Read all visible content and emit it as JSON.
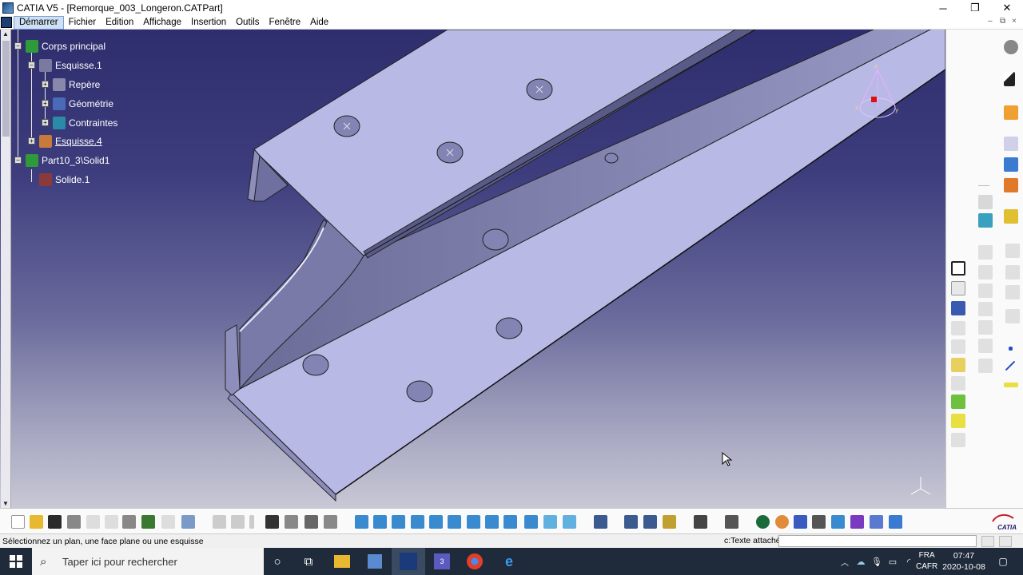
{
  "window": {
    "title": "CATIA V5 - [Remorque_003_Longeron.CATPart]",
    "minimize": "─",
    "restore": "❐",
    "close": "✕"
  },
  "menu": {
    "items": [
      "Démarrer",
      "Fichier",
      "Edition",
      "Affichage",
      "Insertion",
      "Outils",
      "Fenêtre",
      "Aide"
    ],
    "active": "Démarrer",
    "mdi_controls": [
      "–",
      "⧉",
      "×"
    ]
  },
  "tree": {
    "nodes": [
      {
        "label": "Corps principal",
        "icon": "body-icon"
      },
      {
        "label": "Esquisse.1",
        "icon": "sketch-icon"
      },
      {
        "label": "Repère",
        "icon": "axis-system-icon"
      },
      {
        "label": "Géométrie",
        "icon": "geometry-icon"
      },
      {
        "label": "Contraintes",
        "icon": "constraints-icon"
      },
      {
        "label": "Esquisse.4",
        "icon": "sketch-icon",
        "selected": true
      },
      {
        "label": "Part10_3\\Solid1",
        "icon": "solid-body-icon"
      },
      {
        "label": "Solide.1",
        "icon": "solid-icon"
      }
    ]
  },
  "viewport": {
    "background_top": "#2e2e6e",
    "background_bottom": "#c8c8d6",
    "part_color": "#b9b9e6",
    "part_shadow": "#8a8ab8"
  },
  "right_toolbar": {
    "icons": [
      "settings-icon",
      "select-arrow-icon",
      "sketch-edit-icon",
      "text-annotation-icon",
      "measure-icon",
      "pad-icon",
      "pocket-icon",
      "shaft-icon",
      "groove-icon",
      "hole-icon",
      "rib-icon",
      "slot-icon",
      "stiffener-icon",
      "loft-icon",
      "point-icon",
      "line-icon",
      "plane-icon"
    ]
  },
  "bottom_toolbar": {
    "icons": [
      "new-icon",
      "open-icon",
      "save-icon",
      "print-icon",
      "cut-icon",
      "copy-icon",
      "paste-icon",
      "undo-icon",
      "redo-icon",
      "whats-this-icon",
      "formula-icon",
      "knowledge-icon",
      "table-icon",
      "graph-icon",
      "catalog-icon",
      "fly-icon",
      "fit-all-icon",
      "pan-icon",
      "rotate-icon",
      "zoom-in-icon",
      "zoom-out-icon",
      "normal-view-icon",
      "multi-view-icon",
      "iso-view-icon",
      "render-style-icon",
      "hide-show-icon",
      "swap-visible-icon",
      "update-icon",
      "measure-between-icon",
      "mass-icon",
      "inertia-icon",
      "capture-icon",
      "analysis-icon",
      "sync-icon",
      "hand-icon",
      "axis-icon",
      "numeric-icon",
      "cube-icon",
      "tools-icon",
      "list-icon",
      "layer-icon"
    ]
  },
  "brand": {
    "catia_label": "CATIA"
  },
  "status": {
    "message": "Sélectionnez un plan, une face plane ou une esquisse",
    "command_label": "c:Texte attaché",
    "command_value": ""
  },
  "taskbar": {
    "search_placeholder": "Taper ici pour rechercher",
    "lang_top": "FRA",
    "lang_bottom": "CAFR",
    "time": "07:47",
    "date": "2020-10-08",
    "teams_badge": "3"
  }
}
